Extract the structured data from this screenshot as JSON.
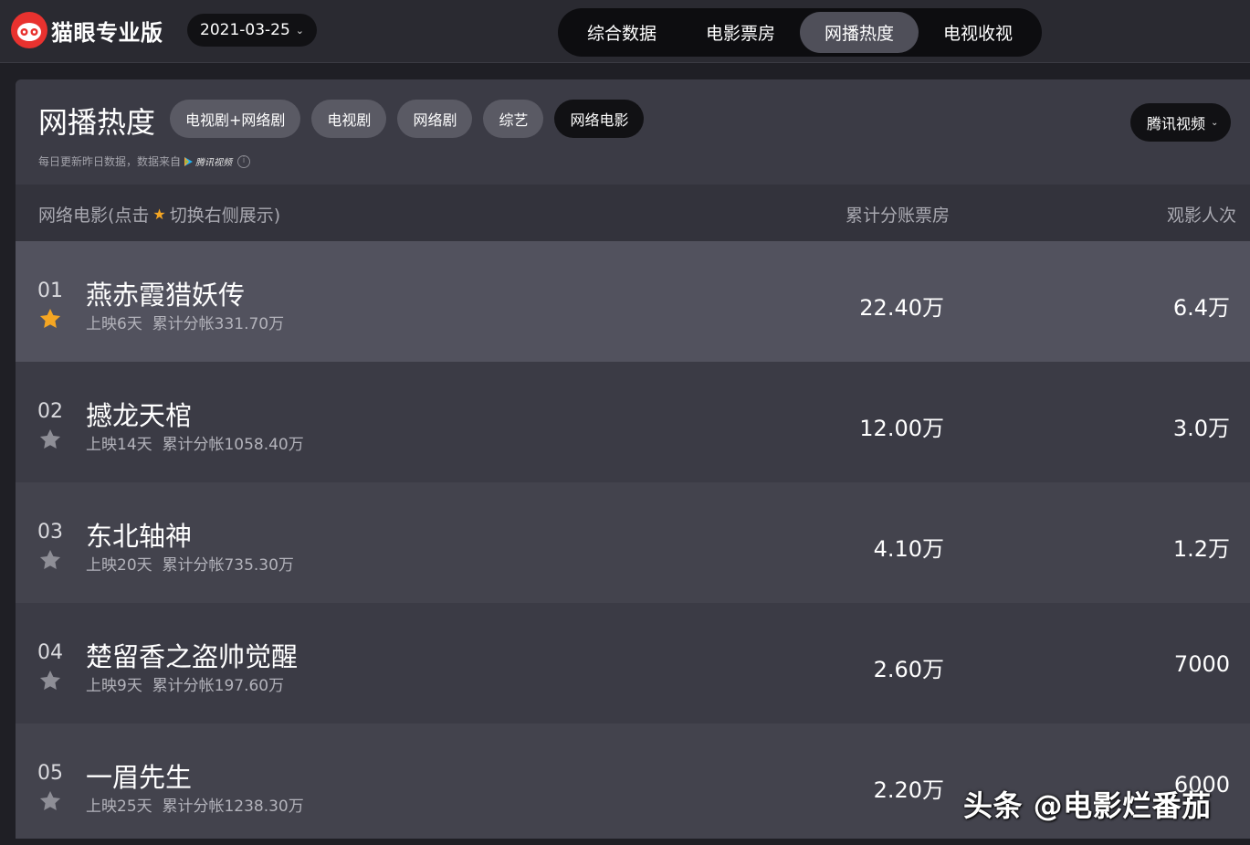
{
  "header": {
    "logo_text": "猫眼专业版",
    "date": "2021-03-25",
    "tabs": [
      {
        "label": "综合数据",
        "active": false
      },
      {
        "label": "电影票房",
        "active": false
      },
      {
        "label": "网播热度",
        "active": true
      },
      {
        "label": "电视收视",
        "active": false
      }
    ]
  },
  "panel": {
    "title": "网播热度",
    "filters": [
      {
        "label": "电视剧+网络剧",
        "active": false
      },
      {
        "label": "电视剧",
        "active": false
      },
      {
        "label": "网络剧",
        "active": false
      },
      {
        "label": "综艺",
        "active": false
      },
      {
        "label": "网络电影",
        "active": true
      }
    ],
    "source_select": "腾讯视频",
    "update_note": "每日更新昨日数据，数据来自",
    "source_logo_text": "腾讯视频"
  },
  "table": {
    "col_name_prefix": "网络电影(点击",
    "col_name_suffix": "切换右侧展示)",
    "col_box": "累计分账票房",
    "col_views": "观影人次",
    "rows": [
      {
        "rank": "01",
        "title": "燕赤霞猎妖传",
        "sub": "上映6天  累计分帐331.70万",
        "box": "22.40万",
        "views": "6.4万",
        "starred": true
      },
      {
        "rank": "02",
        "title": "撼龙天棺",
        "sub": "上映14天  累计分帐1058.40万",
        "box": "12.00万",
        "views": "3.0万",
        "starred": false
      },
      {
        "rank": "03",
        "title": "东北轴神",
        "sub": "上映20天  累计分帐735.30万",
        "box": "4.10万",
        "views": "1.2万",
        "starred": false
      },
      {
        "rank": "04",
        "title": "楚留香之盗帅觉醒",
        "sub": "上映9天  累计分帐197.60万",
        "box": "2.60万",
        "views": "7000",
        "starred": false
      },
      {
        "rank": "05",
        "title": "一眉先生",
        "sub": "上映25天  累计分帐1238.30万",
        "box": "2.20万",
        "views": "6000",
        "starred": false
      }
    ]
  },
  "watermark": "头条 @电影烂番茄",
  "colors": {
    "brand": "#e8322f",
    "star_active": "#f5a623",
    "star_inactive": "#8e8e96"
  }
}
